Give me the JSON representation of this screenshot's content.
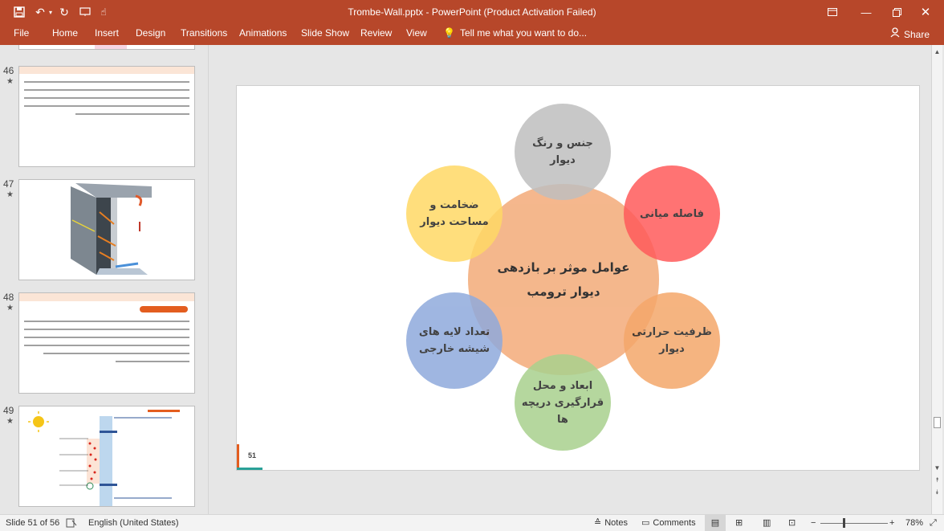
{
  "window": {
    "title": "Trombe-Wall.pptx - PowerPoint (Product Activation Failed)"
  },
  "ribbon": {
    "tabs": [
      "File",
      "Home",
      "Insert",
      "Design",
      "Transitions",
      "Animations",
      "Slide Show",
      "Review",
      "View"
    ],
    "tell_me": "Tell me what you want to do...",
    "share": "Share"
  },
  "thumbnails": [
    {
      "number": "46",
      "kind": "text"
    },
    {
      "number": "47",
      "kind": "image"
    },
    {
      "number": "48",
      "kind": "text"
    },
    {
      "number": "49",
      "kind": "diagram"
    }
  ],
  "slide": {
    "number": "51",
    "center": "عوامل موثر بر بازدهی\nدیوار ترومب",
    "circles": [
      {
        "label": "جنس و رنگ\nدیوار",
        "color": "#bfbfbf"
      },
      {
        "label": "فاصله میانی",
        "color": "#ff5b5b"
      },
      {
        "label": "ظرفیت حرارتی\nدیوار",
        "color": "#f4a76a"
      },
      {
        "label": "ابعاد و محل\nقرارگیری دریچه\nها",
        "color": "#a9d18e"
      },
      {
        "label": "تعداد لایه های\nشیشه خارجی",
        "color": "#8faadc"
      },
      {
        "label": "ضخامت و\nمساحت دیوار",
        "color": "#ffd966"
      }
    ],
    "center_color": "#f4b183"
  },
  "status": {
    "slide_info": "Slide 51 of 56",
    "language": "English (United States)",
    "notes": "Notes",
    "comments": "Comments",
    "zoom": "78%"
  }
}
